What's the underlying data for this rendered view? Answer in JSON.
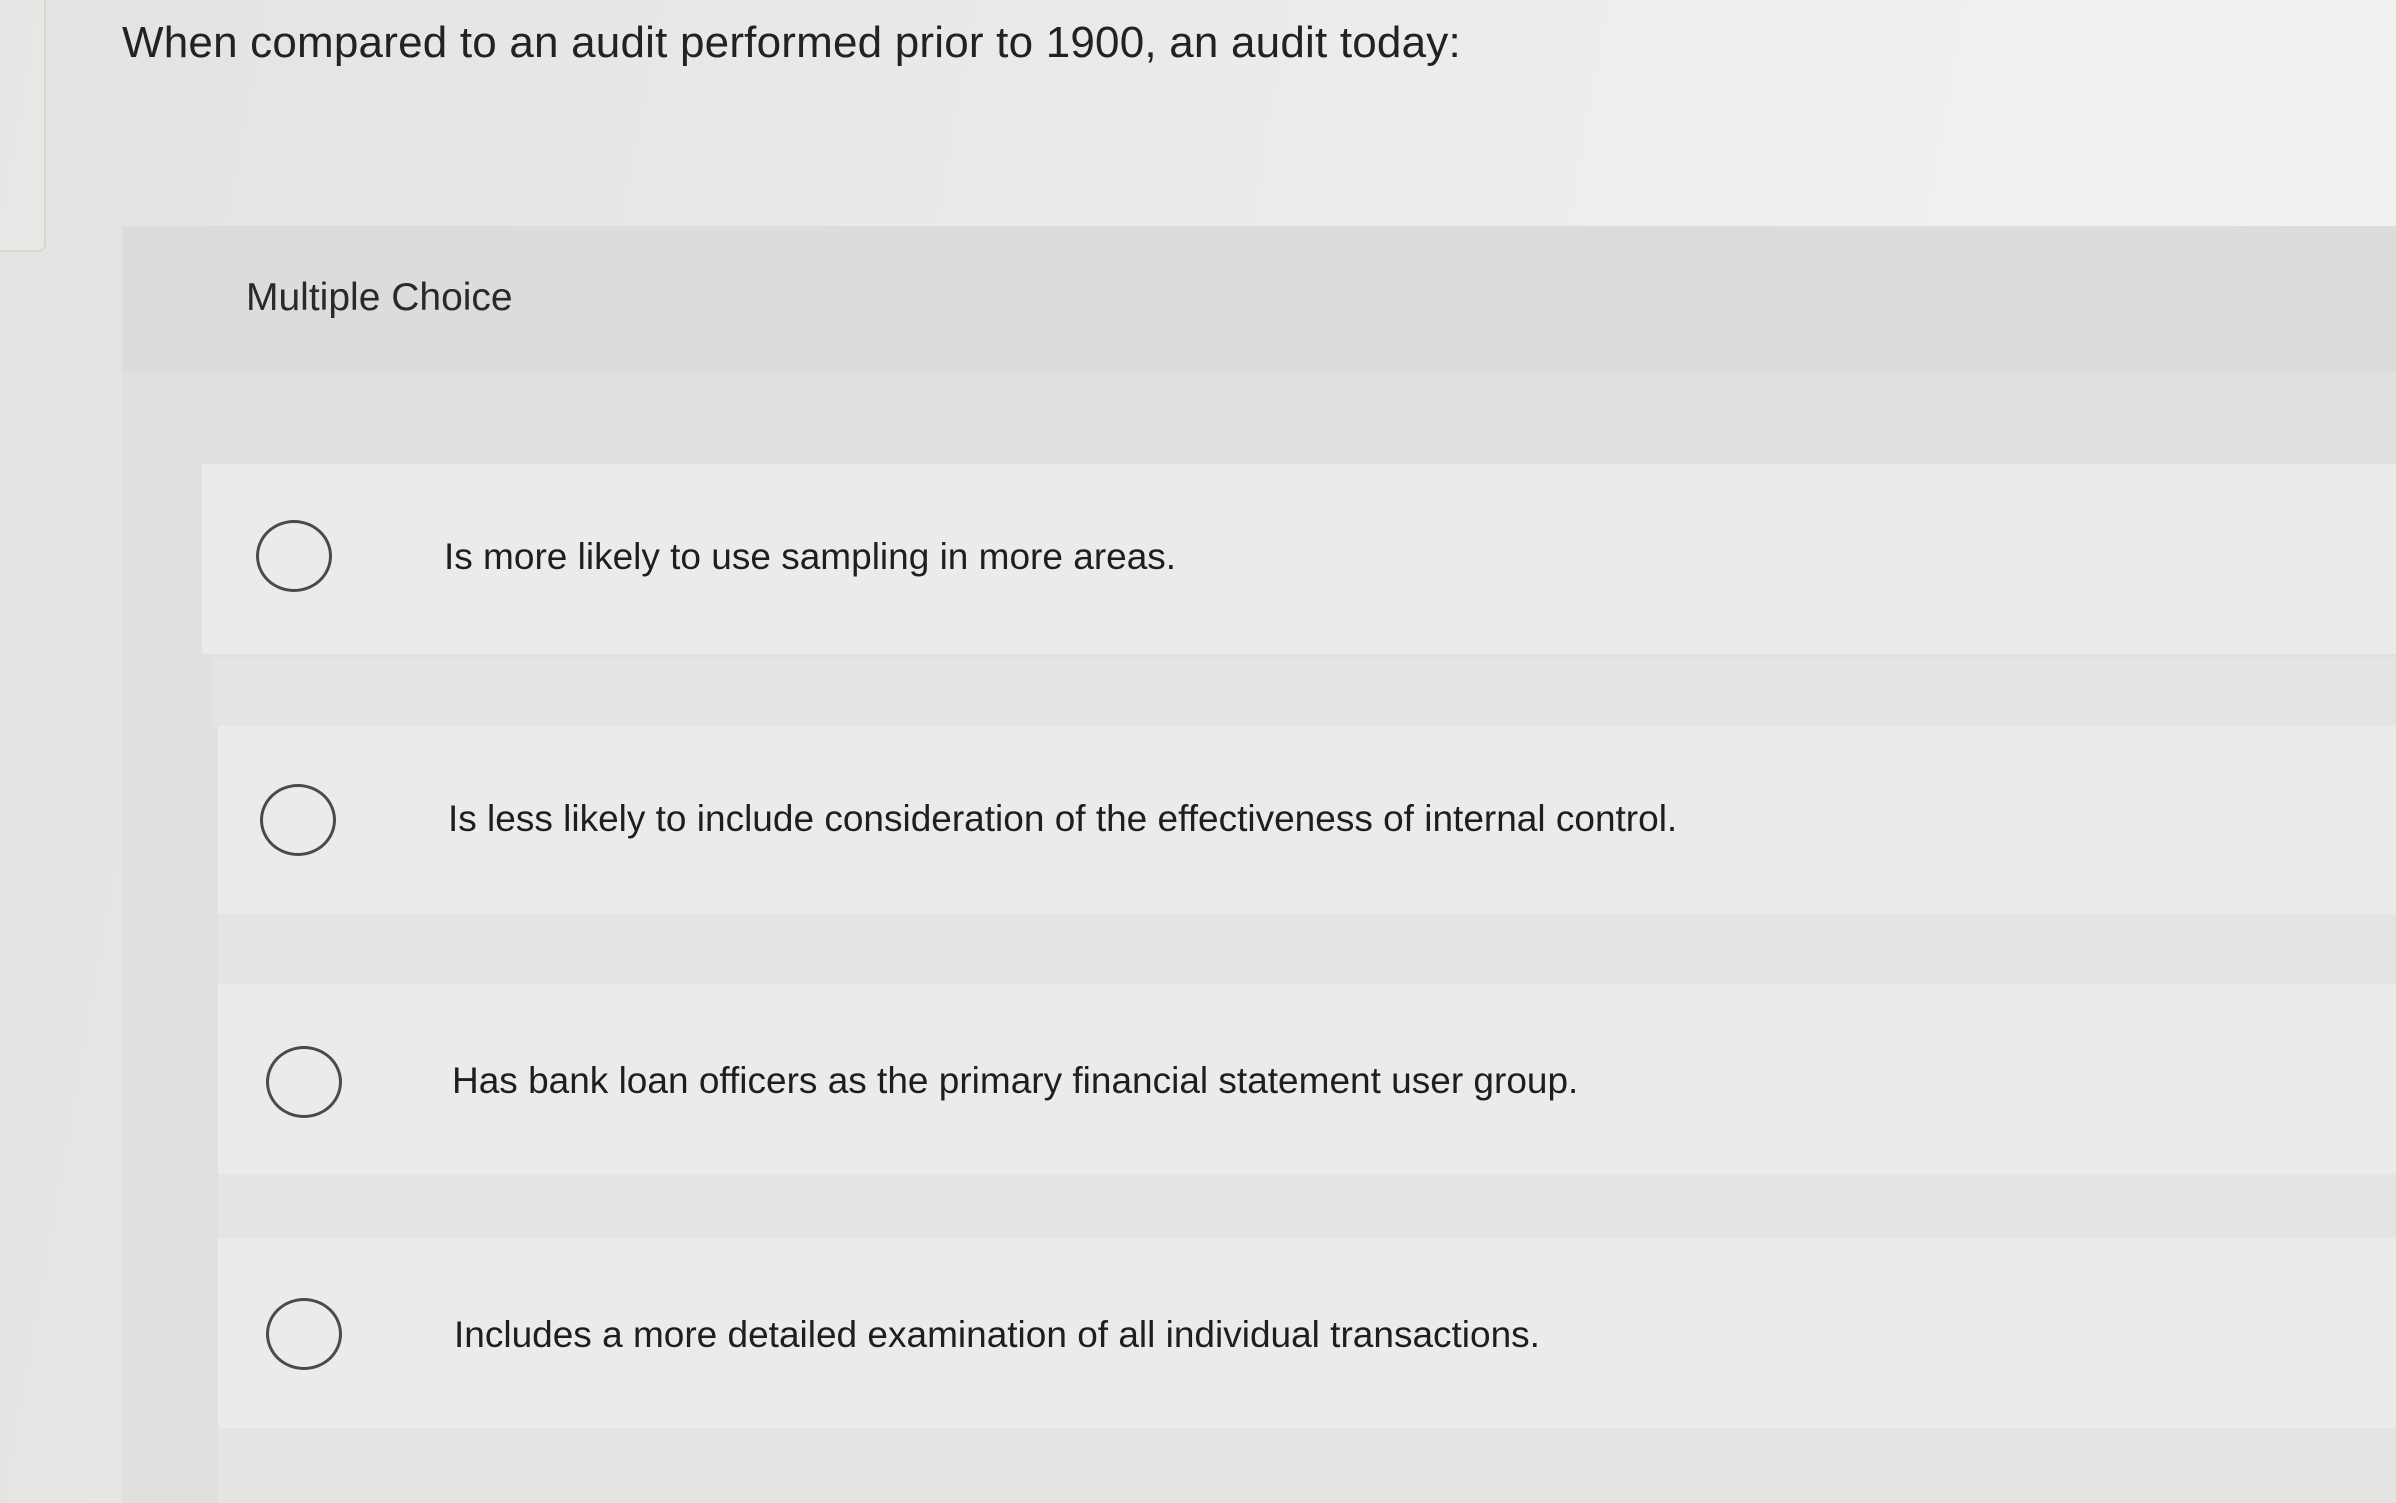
{
  "question": {
    "text": "When compared to an audit performed prior to 1900, an audit today:"
  },
  "multiple_choice": {
    "label": "Multiple Choice",
    "options": [
      {
        "text": "Is more likely to use sampling in more areas.",
        "selected": false
      },
      {
        "text": "Is less likely to include consideration of the effectiveness of internal control.",
        "selected": false
      },
      {
        "text": "Has bank loan officers as the primary financial statement user group.",
        "selected": false
      },
      {
        "text": "Includes a more detailed examination of all individual transactions.",
        "selected": false
      }
    ]
  },
  "colors": {
    "background": "#e9e9e7",
    "panel": "#e0e0de",
    "option_row": "#ebebe9",
    "text": "#1e1e1e",
    "radio_border": "#4a4a4a"
  },
  "icons": {
    "radio": "radio-unselected-icon"
  }
}
